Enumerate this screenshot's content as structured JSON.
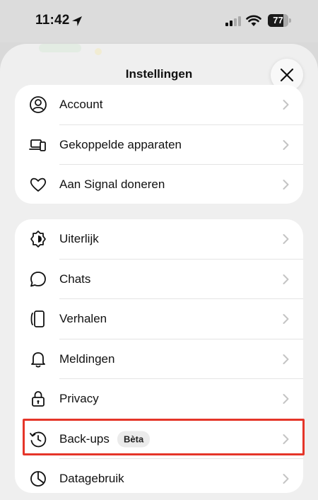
{
  "status_bar": {
    "time": "11:42",
    "battery": "77",
    "battery_level": 0.77,
    "icons": [
      "location-arrow-icon",
      "cellular-signal-icon",
      "wifi-icon",
      "battery-icon"
    ]
  },
  "sheet": {
    "title": "Instellingen",
    "close_icon": "close-icon"
  },
  "group1": [
    {
      "label": "Account",
      "icon": "person-circle-icon"
    },
    {
      "label": "Gekoppelde apparaten",
      "icon": "devices-icon"
    },
    {
      "label": "Aan Signal doneren",
      "icon": "heart-icon"
    }
  ],
  "group2": [
    {
      "label": "Uiterlijk",
      "icon": "appearance-icon"
    },
    {
      "label": "Chats",
      "icon": "chat-bubble-icon"
    },
    {
      "label": "Verhalen",
      "icon": "stories-icon"
    },
    {
      "label": "Meldingen",
      "icon": "bell-icon"
    },
    {
      "label": "Privacy",
      "icon": "lock-icon"
    },
    {
      "label": "Back-ups",
      "icon": "backup-clock-icon",
      "badge": "Bèta"
    },
    {
      "label": "Datagebruik",
      "icon": "pie-chart-icon"
    }
  ],
  "colors": {
    "highlight": "#e53529",
    "chevron": "#c4c4c4"
  }
}
